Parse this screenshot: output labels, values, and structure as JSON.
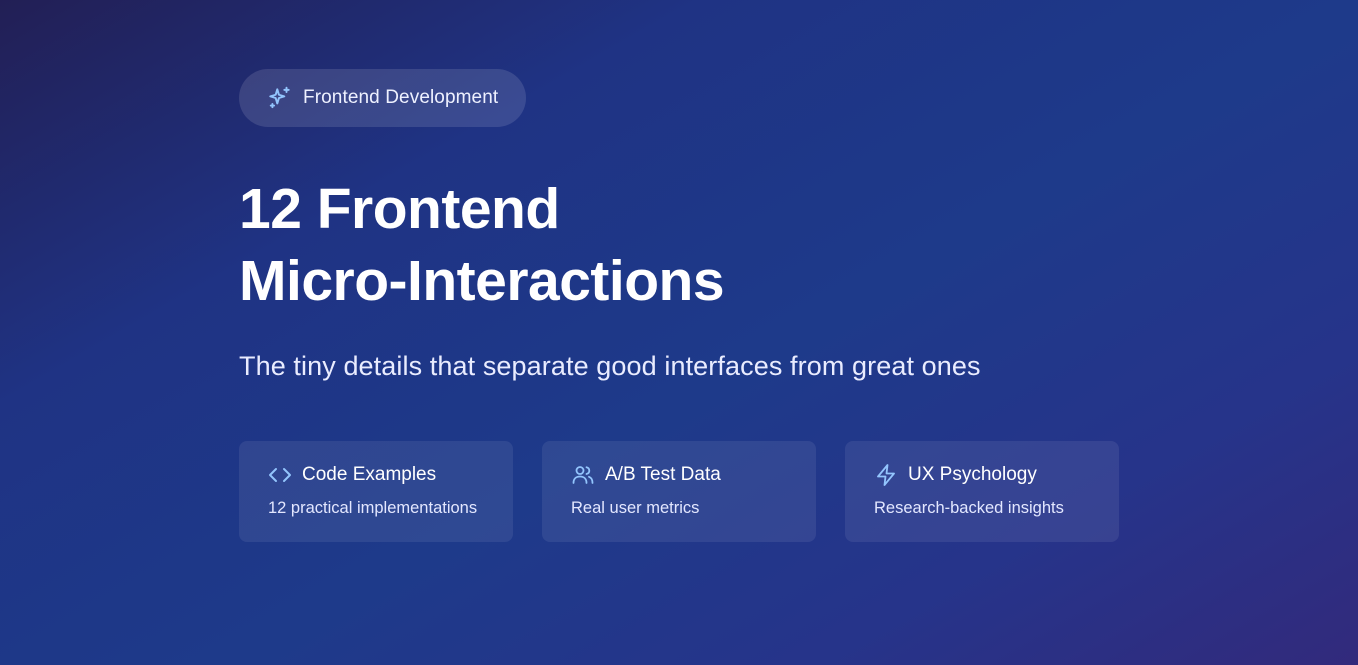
{
  "badge": {
    "icon": "sparkles-icon",
    "label": "Frontend Development"
  },
  "title": {
    "line1": "12 Frontend",
    "line2": "Micro-Interactions"
  },
  "subtitle": "The tiny details that separate good interfaces from great ones",
  "cards": [
    {
      "icon": "code-icon",
      "title": "Code Examples",
      "description": "12 practical implementations"
    },
    {
      "icon": "users-icon",
      "title": "A/B Test Data",
      "description": "Real user metrics"
    },
    {
      "icon": "lightning-icon",
      "title": "UX Psychology",
      "description": "Research-backed insights"
    }
  ],
  "colors": {
    "icon_accent": "#93c5fd",
    "background_start": "#221f55",
    "background_mid": "#1e3a8a",
    "background_end": "#322a7c"
  }
}
